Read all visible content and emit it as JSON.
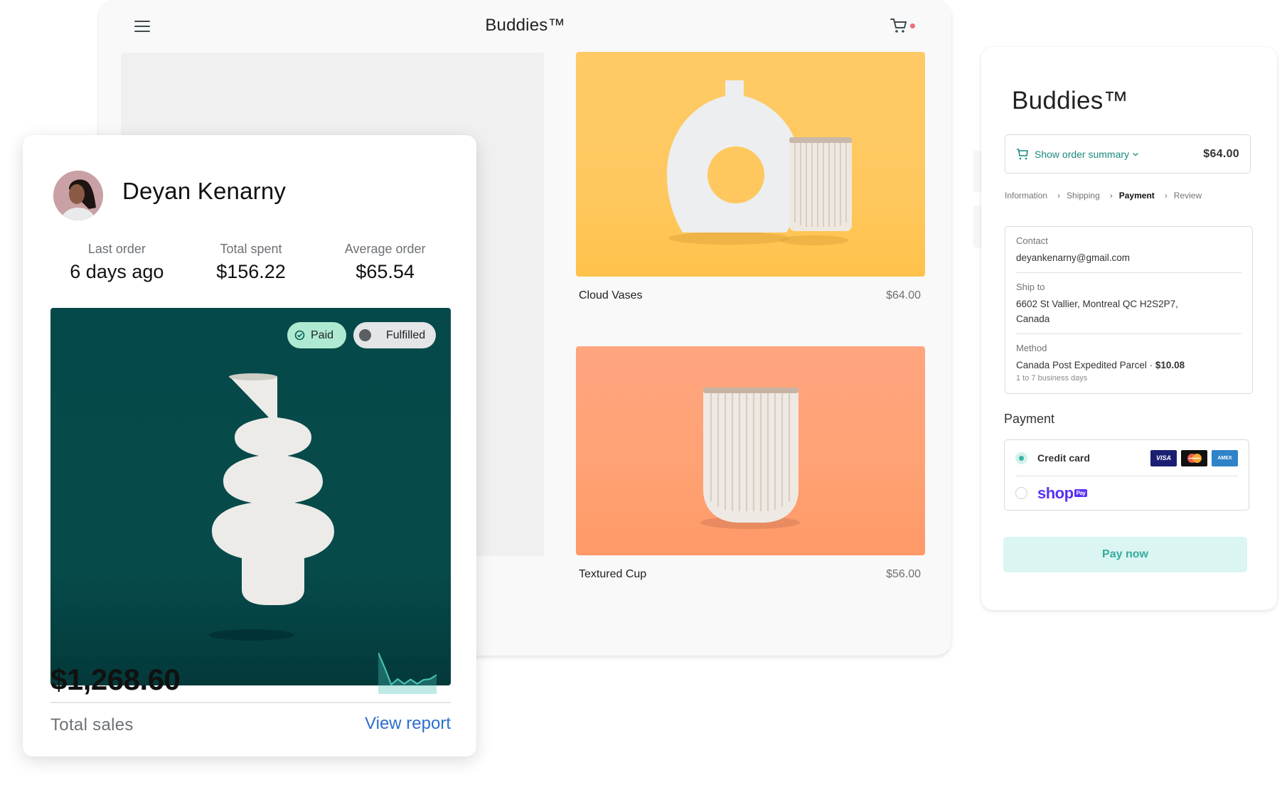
{
  "storefront": {
    "title": "Buddies™",
    "icons": {
      "menu": "hamburger-menu-icon",
      "cart": "shopping-cart-icon"
    },
    "cart_has_items": true,
    "cart_dot_color": "#f36a7d",
    "products": [
      {
        "name": "Cloud Vases",
        "price": "$64.00",
        "image_bg": "#ffc85e"
      },
      {
        "name": "Textured Cup",
        "price": "$56.00",
        "image_bg": "#ffa274"
      }
    ]
  },
  "customer": {
    "name": "Deyan Kenarny",
    "stats": [
      {
        "label": "Last order",
        "value": "6 days ago"
      },
      {
        "label": "Total spent",
        "value": "$156.22"
      },
      {
        "label": "Average order",
        "value": "$65.54"
      }
    ],
    "badges": {
      "paid": "Paid",
      "fulfilled": "Fulfilled"
    },
    "total_sales_value": "$1,268.60",
    "total_sales_label": "Total sales",
    "view_report_label": "View report",
    "sparkline": [
      100,
      62,
      20,
      34,
      22,
      33,
      22,
      32,
      34,
      44
    ],
    "colors": {
      "hero_bg": "#064a4a",
      "paid_badge": "#aeead2",
      "link": "#2c6ecb",
      "sparkline": "#47c1b4"
    }
  },
  "checkout": {
    "brand": "Buddies™",
    "order_summary_label": "Show order summary",
    "order_total": "$64.00",
    "breadcrumbs": [
      {
        "label": "Information",
        "active": false
      },
      {
        "label": "Shipping",
        "active": false
      },
      {
        "label": "Payment",
        "active": true
      },
      {
        "label": "Review",
        "active": false
      }
    ],
    "contact": {
      "label": "Contact",
      "value": "deyankenarny@gmail.com"
    },
    "ship_to": {
      "label": "Ship to",
      "line1": "6602 St Vallier, Montreal QC  H2S2P7,",
      "line2": "Canada"
    },
    "method": {
      "label": "Method",
      "name": "Canada Post Expedited Parcel · ",
      "price": "$10.08",
      "eta": "1 to 7 business days"
    },
    "payment_heading": "Payment",
    "payment_options": [
      {
        "label": "Credit card",
        "selected": true,
        "cards": [
          "VISA",
          "Mastercard",
          "AMEX"
        ]
      },
      {
        "label": "shop",
        "badge": "Pay",
        "selected": false
      }
    ],
    "pay_now_label": "Pay now",
    "colors": {
      "accent": "#1a8a7c",
      "pay_button_bg": "#daf5f2",
      "pay_button_text": "#35ab9d",
      "shop_pay": "#5a31f4"
    }
  }
}
